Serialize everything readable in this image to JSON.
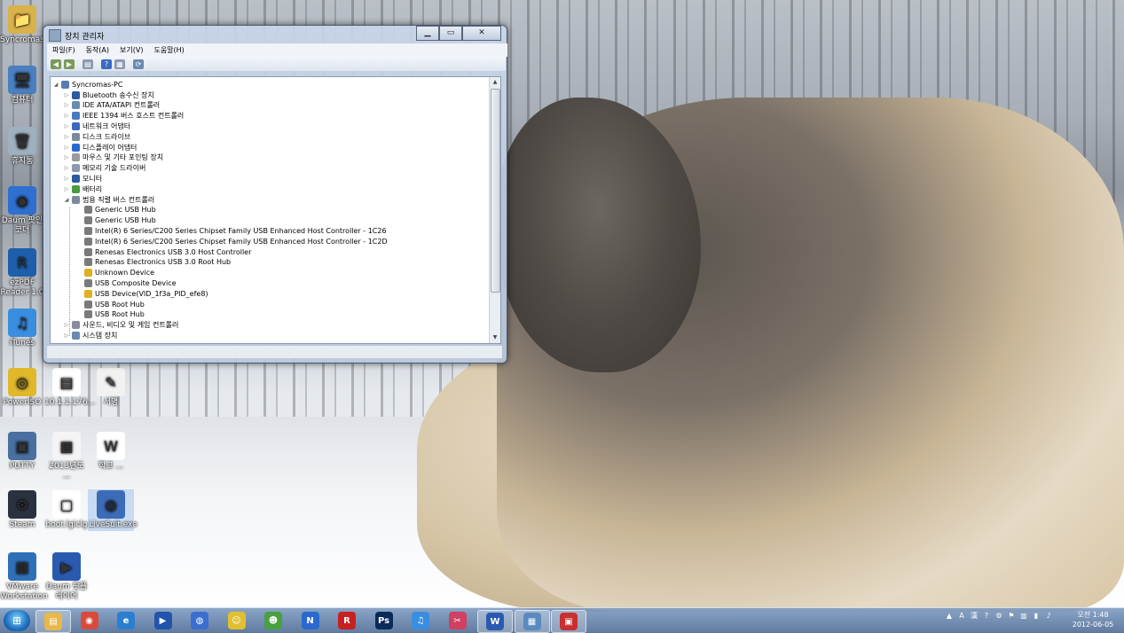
{
  "desktop_icons": [
    {
      "label": "Syncromas",
      "color": "#d8b24a",
      "glyph": "📁"
    },
    {
      "label": "컴퓨터",
      "color": "#4a7fc0",
      "glyph": "🖥"
    },
    {
      "label": "휴지통",
      "color": "#9fb0c0",
      "glyph": "🗑"
    },
    {
      "label": "Daum 팟인코더",
      "color": "#2e6fd0",
      "glyph": "◉"
    },
    {
      "label": "ezPDF Reader 1.0",
      "color": "#1d5faa",
      "glyph": "R"
    },
    {
      "label": "iTunes",
      "color": "#3a8ee0",
      "glyph": "♫"
    },
    {
      "label": "PowerISO",
      "color": "#e0b82a",
      "glyph": "◎"
    },
    {
      "label": "10.1.1.176...",
      "color": "#ffffff",
      "glyph": "▤"
    },
    {
      "label": "서명",
      "color": "#f2f2f2",
      "glyph": "✎"
    },
    {
      "label": "PUTTY",
      "color": "#4a6fa0",
      "glyph": "▣"
    },
    {
      "label": "2013년도 ...",
      "color": "#f4f4f4",
      "glyph": "▦"
    },
    {
      "label": "학교 ...",
      "color": "#ffffff",
      "glyph": "W"
    },
    {
      "label": "Steam",
      "color": "#2a3240",
      "glyph": "⚙"
    },
    {
      "label": "boot.lgiclg",
      "color": "#ffffff",
      "glyph": "▢"
    },
    {
      "label": "LiveSuit.exe",
      "color": "#3c6cb8",
      "glyph": "◍"
    },
    {
      "label": "VMware Workstation",
      "color": "#2f6fb8",
      "glyph": "▩"
    },
    {
      "label": "Daum 팟플레이어",
      "color": "#2a5ab0",
      "glyph": "▶"
    }
  ],
  "window": {
    "title": "장치 관리자",
    "min": "▁",
    "max": "▭",
    "close": "✕",
    "menu": [
      "파일(F)",
      "동작(A)",
      "보기(V)",
      "도움말(H)"
    ],
    "toolbar": [
      "back-icon",
      "forward-icon",
      "properties-icon",
      "help-icon",
      "view-icon",
      "scan-icon"
    ],
    "root": "Syncromas-PC",
    "categories": [
      "Bluetooth 송수신 장치",
      "IDE ATA/ATAPI 컨트롤러",
      "IEEE 1394 버스 호스트 컨트롤러",
      "네트워크 어댑터",
      "디스크 드라이브",
      "디스플레이 어댑터",
      "마우스 및 기타 포인팅 장치",
      "메모리 기술 드라이버",
      "모니터",
      "배터리",
      "범용 직렬 버스 컨트롤러"
    ],
    "usb_children": [
      "Generic USB Hub",
      "Generic USB Hub",
      "Intel(R) 6 Series/C200 Series Chipset Family USB Enhanced Host Controller - 1C26",
      "Intel(R) 6 Series/C200 Series Chipset Family USB Enhanced Host Controller - 1C2D",
      "Renesas Electronics USB 3.0 Host Controller",
      "Renesas Electronics USB 3.0 Root Hub",
      "Unknown Device",
      "USB Composite Device",
      "USB Device(VID_1f3a_PID_efe8)",
      "USB Root Hub",
      "USB Root Hub"
    ],
    "after_usb": [
      "사운드, 비디오 및 게임 컨트롤러",
      "시스템 장치"
    ]
  },
  "taskbar": {
    "items": [
      {
        "name": "explorer",
        "color": "#e8b84a"
      },
      {
        "name": "chrome",
        "color": "#d94a3a"
      },
      {
        "name": "internet-explorer",
        "color": "#2a7fd0"
      },
      {
        "name": "daum-pot-player",
        "color": "#2255aa"
      },
      {
        "name": "daum-pot-encoder",
        "color": "#3a6fd0"
      },
      {
        "name": "messenger",
        "color": "#e0c030"
      },
      {
        "name": "frog-app",
        "color": "#4aa040"
      },
      {
        "name": "nate",
        "color": "#2a6ad0"
      },
      {
        "name": "ezpdf",
        "color": "#c82020"
      },
      {
        "name": "photoshop",
        "color": "#0a2a5a"
      },
      {
        "name": "itunes",
        "color": "#3a8ee0"
      },
      {
        "name": "snipping-tool",
        "color": "#d04060"
      },
      {
        "name": "word",
        "color": "#2a5ab0"
      },
      {
        "name": "device-manager",
        "color": "#5a8ac0"
      },
      {
        "name": "toolbox",
        "color": "#c83030"
      }
    ],
    "clock_time": "오전 1:48",
    "clock_date": "2012-06-05"
  }
}
